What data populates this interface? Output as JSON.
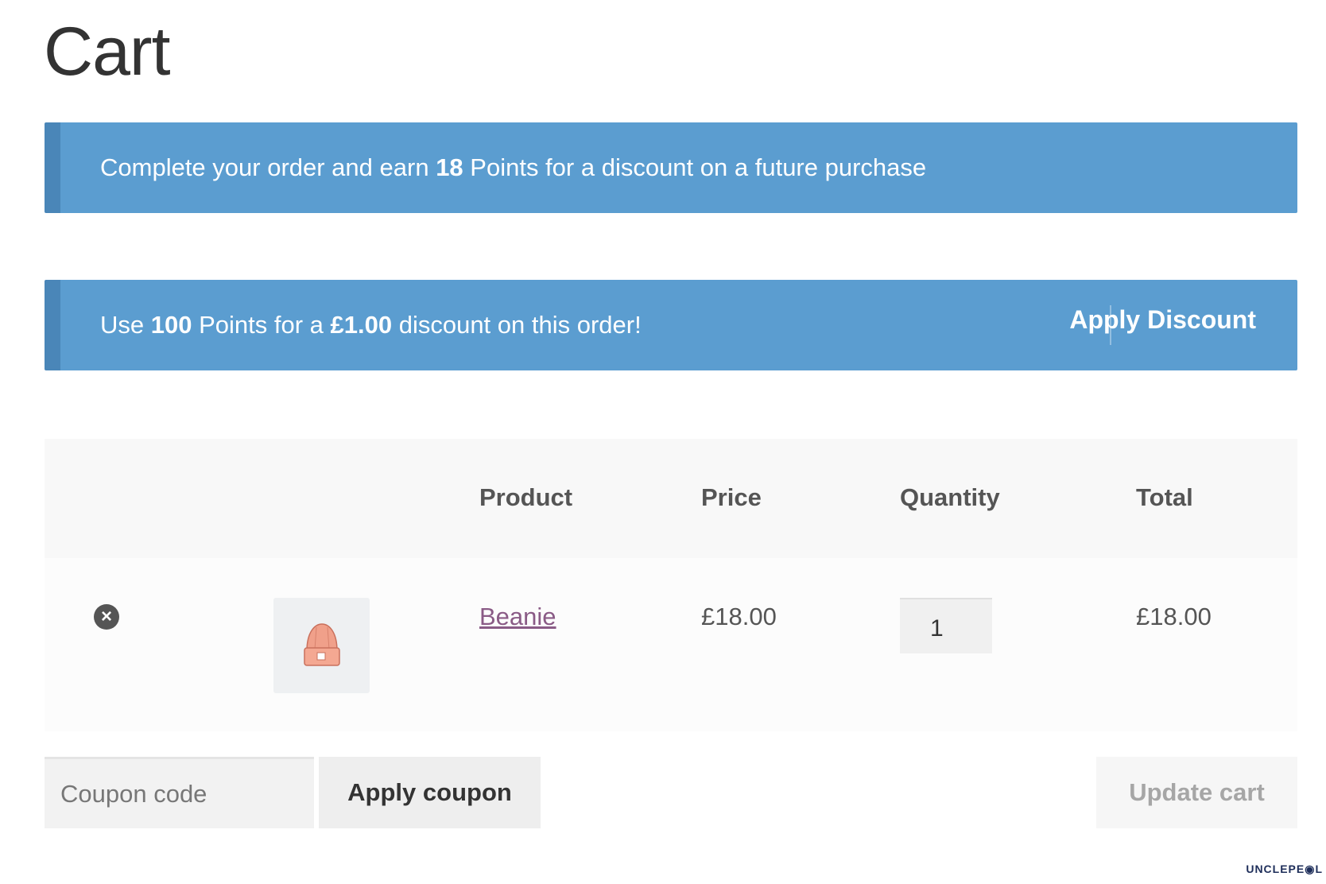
{
  "page": {
    "title": "Cart"
  },
  "notices": {
    "earn": {
      "prefix": "Complete your order and earn ",
      "points": "18",
      "suffix": " Points for a discount on a future purchase"
    },
    "redeem": {
      "prefix": "Use ",
      "points": "100",
      "middle": " Points for a ",
      "amount": "£1.00",
      "suffix": " discount on this order!",
      "action_label": "Apply Discount"
    },
    "color": "#5b9dd0"
  },
  "cart": {
    "headers": {
      "product": "Product",
      "price": "Price",
      "quantity": "Quantity",
      "total": "Total"
    },
    "items": [
      {
        "remove_icon": "remove-circle-icon",
        "thumbnail_icon": "beanie-icon",
        "name": "Beanie",
        "price": "£18.00",
        "quantity": "1",
        "total": "£18.00"
      }
    ]
  },
  "actions": {
    "coupon_placeholder": "Coupon code",
    "apply_coupon_label": "Apply coupon",
    "update_cart_label": "Update cart"
  },
  "watermark": "UNCLEPE◉L"
}
